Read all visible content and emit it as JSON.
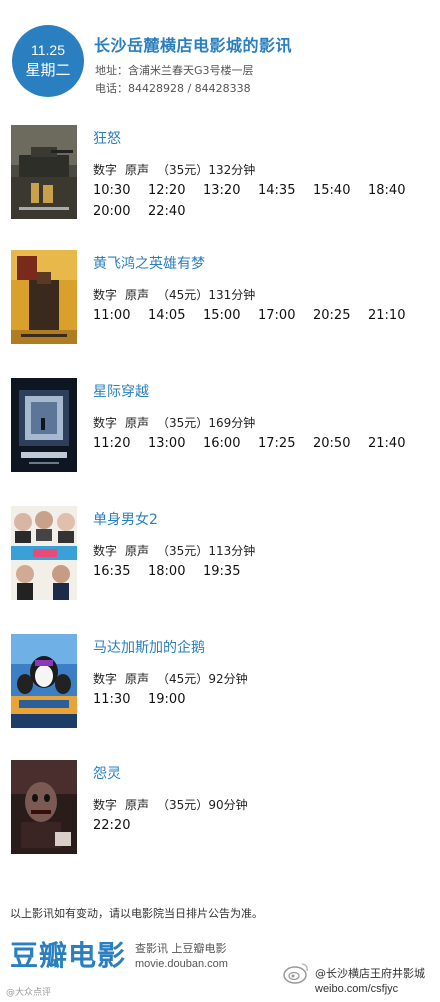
{
  "header": {
    "date": "11.25",
    "weekday": "星期二",
    "cinema_name": "长沙岳麓横店电影城的影讯",
    "address": "地址：含浦米兰春天G3号楼一层",
    "phone": "电话：84428928 / 84428338"
  },
  "movies": [
    {
      "title": "狂怒",
      "format": "数字",
      "audio": "原声",
      "price": "（35元）",
      "duration": "132分钟",
      "times": [
        "10:30",
        "12:20",
        "13:20",
        "14:35",
        "15:40",
        "18:40",
        "20:00",
        "22:40"
      ]
    },
    {
      "title": "黄飞鸿之英雄有梦",
      "format": "数字",
      "audio": "原声",
      "price": "（45元）",
      "duration": "131分钟",
      "times": [
        "11:00",
        "14:05",
        "15:00",
        "17:00",
        "20:25",
        "21:10"
      ]
    },
    {
      "title": "星际穿越",
      "format": "数字",
      "audio": "原声",
      "price": "（35元）",
      "duration": "169分钟",
      "times": [
        "11:20",
        "13:00",
        "16:00",
        "17:25",
        "20:50",
        "21:40"
      ]
    },
    {
      "title": "单身男女2",
      "format": "数字",
      "audio": "原声",
      "price": "（35元）",
      "duration": "113分钟",
      "times": [
        "16:35",
        "18:00",
        "19:35"
      ]
    },
    {
      "title": "马达加斯加的企鹅",
      "format": "数字",
      "audio": "原声",
      "price": "（45元）",
      "duration": "92分钟",
      "times": [
        "11:30",
        "19:00"
      ]
    },
    {
      "title": "怨灵",
      "format": "数字",
      "audio": "原声",
      "price": "（35元）",
      "duration": "90分钟",
      "times": [
        "22:20"
      ]
    }
  ],
  "footer": {
    "notice": "以上影讯如有变动，请以电影院当日排片公告为准。",
    "brand": "豆瓣电影",
    "brand_sub": "查影讯  上豆瓣电影",
    "brand_url": "movie.douban.com",
    "watermark_name": "@长沙横店王府井影城",
    "watermark_url": "weibo.com/csfjyc",
    "corner_mark": "@大众点评"
  },
  "colors": {
    "accent": "#2a7fc1"
  }
}
